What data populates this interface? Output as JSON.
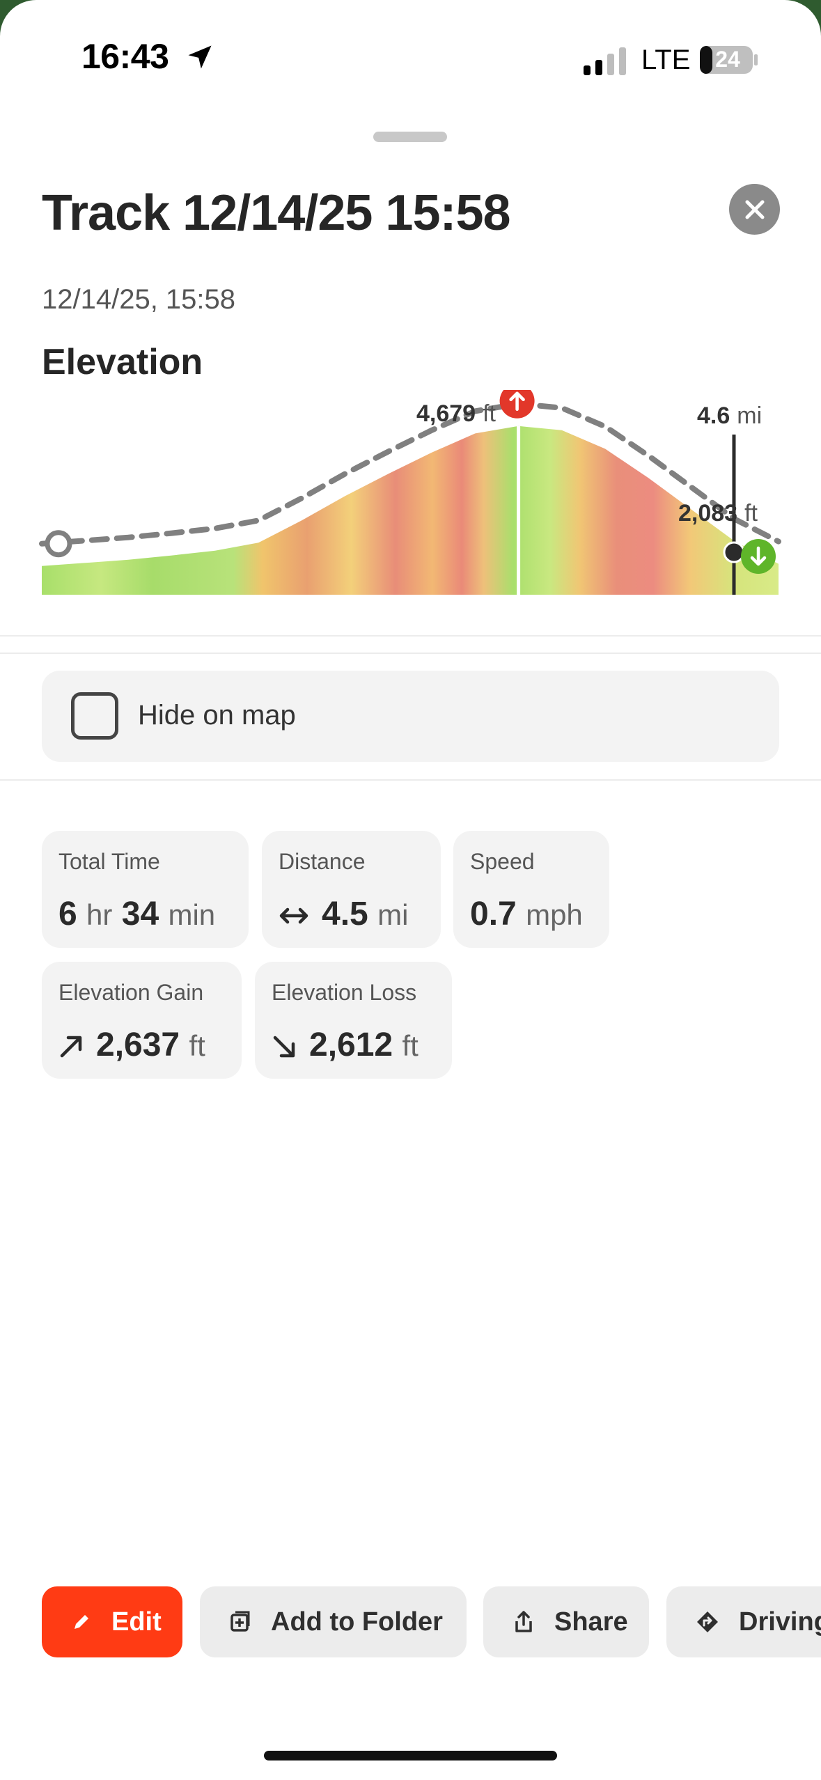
{
  "status_bar": {
    "time": "16:43",
    "network": "LTE",
    "battery": "24"
  },
  "header": {
    "title": "Track 12/14/25 15:58",
    "subtitle": "12/14/25, 15:58",
    "close_icon": "close-icon"
  },
  "elevation": {
    "heading": "Elevation",
    "max_value": "4,679",
    "max_unit": "ft",
    "cursor_distance": "4.6",
    "cursor_distance_unit": "mi",
    "cursor_elevation": "2,083",
    "cursor_elevation_unit": "ft"
  },
  "chart_data": {
    "type": "area",
    "title": "Elevation",
    "xlabel": "",
    "ylabel": "",
    "annotations": [
      "4,679 ft",
      "4.6 mi",
      "2,083 ft"
    ],
    "series": [
      {
        "values": [
          2042,
          2100,
          2160,
          2240,
          2330,
          2480,
          2900,
          3360,
          3780,
          4180,
          4540,
          4679,
          4600,
          4250,
          3700,
          3100,
          2500,
          2083
        ]
      }
    ],
    "colors": {
      "gain": "#e2372a",
      "low": "#8fd14f",
      "mid": "#f0c060",
      "marker_gain": "#e2372a",
      "marker_loss": "#5fb52a"
    }
  },
  "hide_on_map": {
    "label": "Hide on map",
    "checked": false
  },
  "stats": {
    "total_time": {
      "label": "Total Time",
      "hours": "6",
      "hours_unit": "hr",
      "minutes": "34",
      "minutes_unit": "min"
    },
    "distance": {
      "label": "Distance",
      "value": "4.5",
      "unit": "mi",
      "icon": "double-arrow-icon"
    },
    "speed": {
      "label": "Speed",
      "value": "0.7",
      "unit": "mph"
    },
    "elevation_gain": {
      "label": "Elevation Gain",
      "value": "2,637",
      "unit": "ft",
      "icon": "arrow-up-right-icon"
    },
    "elevation_loss": {
      "label": "Elevation Loss",
      "value": "2,612",
      "unit": "ft",
      "icon": "arrow-down-right-icon"
    }
  },
  "actions": {
    "edit": "Edit",
    "add_to_folder": "Add to Folder",
    "share": "Share",
    "driving": "Driving"
  }
}
